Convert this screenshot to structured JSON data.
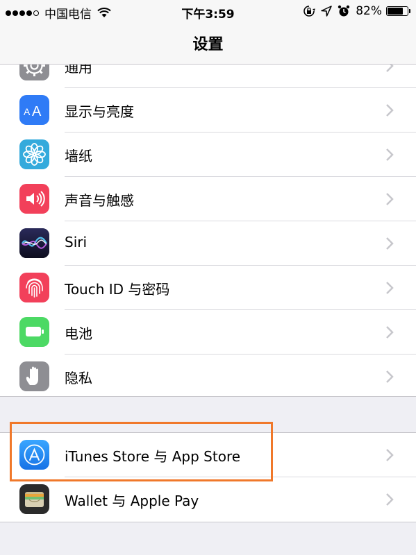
{
  "status_bar": {
    "carrier": "中国电信",
    "time": "下午3:59",
    "battery_percent": "82%",
    "battery_level": 0.82
  },
  "nav": {
    "title": "设置"
  },
  "groups": [
    {
      "items": [
        {
          "label": "通用",
          "icon": "gear-icon",
          "color": "#8e8e93"
        },
        {
          "label": "显示与亮度",
          "icon": "display-brightness-icon",
          "color": "#2f7bf6"
        },
        {
          "label": "墙纸",
          "icon": "wallpaper-flower-icon",
          "color": "#34aadc"
        },
        {
          "label": "声音与触感",
          "icon": "speaker-icon",
          "color": "#f2405a"
        },
        {
          "label": "Siri",
          "icon": "siri-icon",
          "color": "#1b1b3a"
        },
        {
          "label": "Touch ID 与密码",
          "icon": "fingerprint-icon",
          "color": "#f2405a"
        },
        {
          "label": "电池",
          "icon": "battery-icon",
          "color": "#4cd964"
        },
        {
          "label": "隐私",
          "icon": "hand-icon",
          "color": "#8e8e93"
        }
      ]
    },
    {
      "items": [
        {
          "label": "iTunes Store 与 App Store",
          "icon": "app-store-icon",
          "color": "#1e8ff2"
        },
        {
          "label": "Wallet 与 Apple Pay",
          "icon": "wallet-icon",
          "color": "#2b2b2b"
        }
      ]
    }
  ],
  "highlight_color": "#f0782a"
}
